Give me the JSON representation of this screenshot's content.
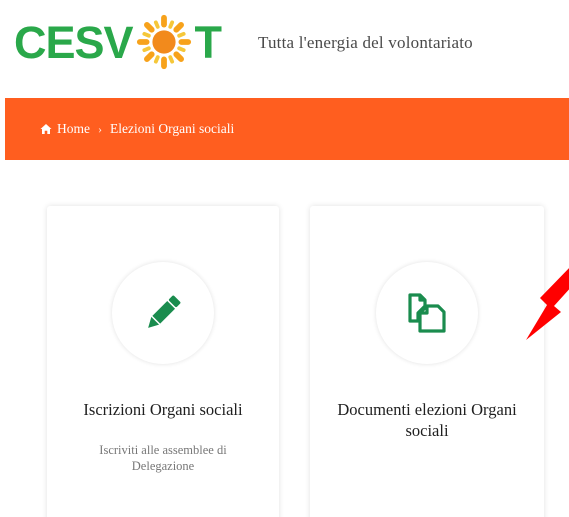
{
  "header": {
    "logo_prefix": "CESV",
    "logo_suffix": "T",
    "tagline": "Tutta l'energia del volontariato"
  },
  "breadcrumb": {
    "home_label": "Home",
    "separator": "›",
    "current": "Elezioni Organi sociali"
  },
  "cards": [
    {
      "title": "Iscrizioni Organi sociali",
      "description": "Iscriviti alle assemblee di Delegazione",
      "icon": "pencil-icon"
    },
    {
      "title": "Documenti elezioni Organi sociali",
      "description": "",
      "icon": "documents-icon"
    }
  ],
  "colors": {
    "brand_green": "#2aa84a",
    "brand_orange": "#ff5e1f",
    "icon_green": "#1a8c4e",
    "annotation_red": "#ff0000"
  }
}
